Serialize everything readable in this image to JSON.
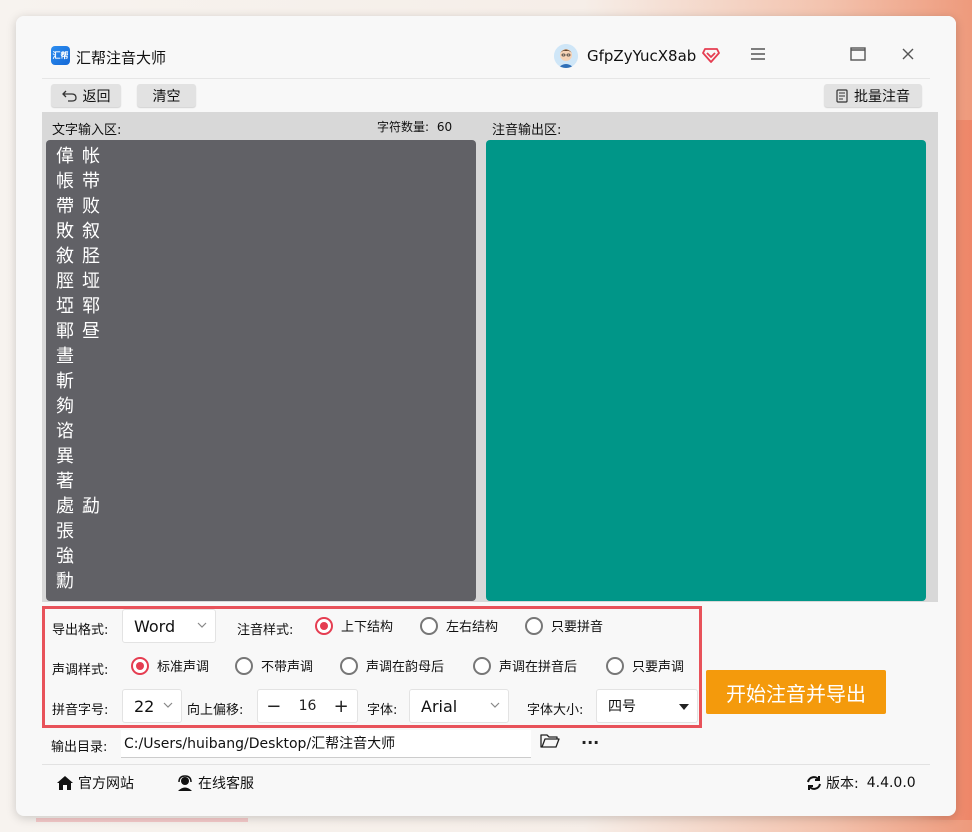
{
  "app": {
    "title": "汇帮注音大师",
    "logo_text": "汇帮"
  },
  "user": {
    "name": "GfpZyYucX8ab"
  },
  "toolbar": {
    "back_label": "返回",
    "clear_label": "清空",
    "batch_label": "批量注音"
  },
  "input_panel": {
    "label": "文字输入区:",
    "char_count_label": "字符数量:",
    "char_count": "60",
    "col1": [
      "偉",
      "帳",
      "帶",
      "敗",
      "敘",
      "脛",
      "埡",
      "鄆",
      "晝",
      "斬",
      "夠",
      "谘",
      "異",
      "著",
      "處",
      "張",
      "強",
      "勳"
    ],
    "col2": [
      "帐",
      "带",
      "败",
      "叙",
      "胫",
      "垭",
      "郓",
      "昼",
      "",
      "",
      "",
      "",
      "",
      "",
      "勐"
    ]
  },
  "output_panel": {
    "label": "注音输出区:"
  },
  "options": {
    "export_format_label": "导出格式:",
    "export_format_value": "Word",
    "annotation_style_label": "注音样式:",
    "annotation_styles": [
      "上下结构",
      "左右结构",
      "只要拼音"
    ],
    "tone_style_label": "声调样式:",
    "tone_styles": [
      "标准声调",
      "不带声调",
      "声调在韵母后",
      "声调在拼音后",
      "只要声调"
    ],
    "pinyin_size_label": "拼音字号:",
    "pinyin_size_value": "22",
    "offset_label": "向上偏移:",
    "offset_value": "16",
    "font_label": "字体:",
    "font_value": "Arial",
    "font_size_label": "字体大小:",
    "font_size_value": "四号"
  },
  "start_button_label": "开始注音并导出",
  "output_dir": {
    "label": "输出目录:",
    "path": "C:/Users/huibang/Desktop/汇帮注音大师"
  },
  "footer": {
    "website_label": "官方网站",
    "support_label": "在线客服",
    "version_label": "版本:",
    "version": "4.4.0.0"
  },
  "colors": {
    "accent_red": "#e53d51",
    "output_bg": "#009688",
    "input_bg": "#616166",
    "start_button": "#f49a0c"
  }
}
